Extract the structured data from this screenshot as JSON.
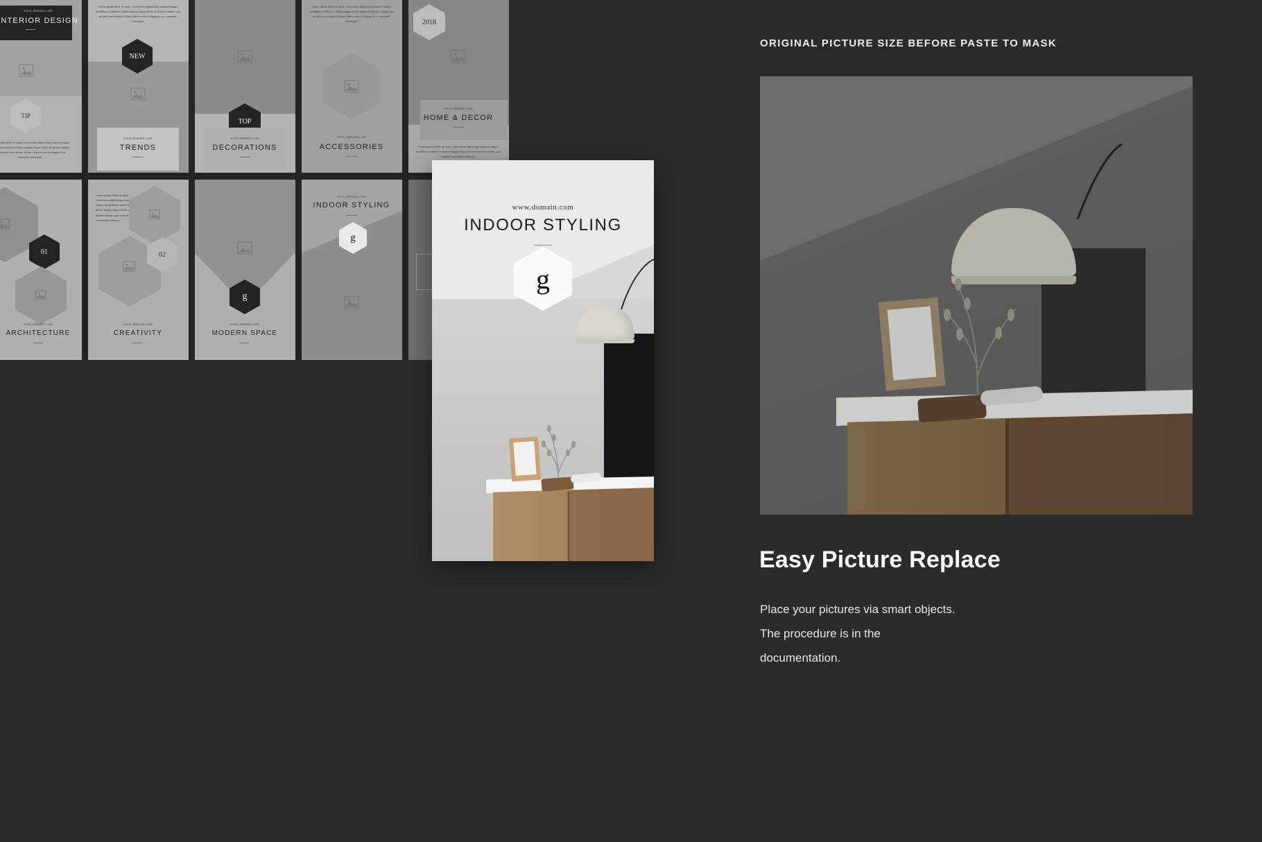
{
  "page": {
    "background": "#2b2b2b",
    "accent_dark": "#232326",
    "paper": "#eceae6"
  },
  "grid": {
    "domain_small": "www.domain.com",
    "lorem_long": "Lorem ipsum dolor sit amet, consectetur adipisicing eiusmod tempor incididunt ut labore et dolore magna aliqua. Enim ad minim veniam, quis nostrud exercitation ullamco laboris nisi ut aliquip ex ea commodo consequat.",
    "lorem_short": "Lorem ipsum dolor sit amet, consectetur adipisicing eiusmod tempor incididunt ut labore et dolore magna aliqua. Enim ad minim veniam, quis nostrud exercitation ullamco.",
    "lorem_block": "Lorem ipsum dolor sit amet, consectetur adipisicing eiusmod tempor incididunt ut labore et dolore magna aliqua. Enim ad minim veniam, quis nostrud exercitation ullamco.",
    "cards": [
      {
        "label": "INTERIOR DESIGN",
        "badge": "TIP"
      },
      {
        "label": "TRENDS",
        "badge": "NEW"
      },
      {
        "label": "DECORATIONS",
        "badge": "TOP"
      },
      {
        "label": "ACCESSORIES",
        "badge": ""
      },
      {
        "label": "HOME & DECOR",
        "badge": "2018"
      },
      {
        "label": "ARCHITECTURE",
        "badge": "01"
      },
      {
        "label": "CREATIVITY",
        "badge": "02"
      },
      {
        "label": "MODERN SPACE",
        "badge": "g"
      },
      {
        "label": "INDOOR STYLING",
        "badge": "g"
      },
      {
        "label": "",
        "badge": ""
      }
    ]
  },
  "poster": {
    "domain": "www.domain.com",
    "title": "INDOOR STYLING",
    "logo_mark": "g"
  },
  "right": {
    "caption": "ORIGINAL PICTURE SIZE BEFORE PASTE TO MASK",
    "heading": "Easy Picture Replace",
    "body_line1": "Place your pictures via smart objects.",
    "body_line2": "The procedure is in the",
    "body_line3": "documentation."
  },
  "icons": {
    "image_placeholder": "image-placeholder-icon"
  }
}
